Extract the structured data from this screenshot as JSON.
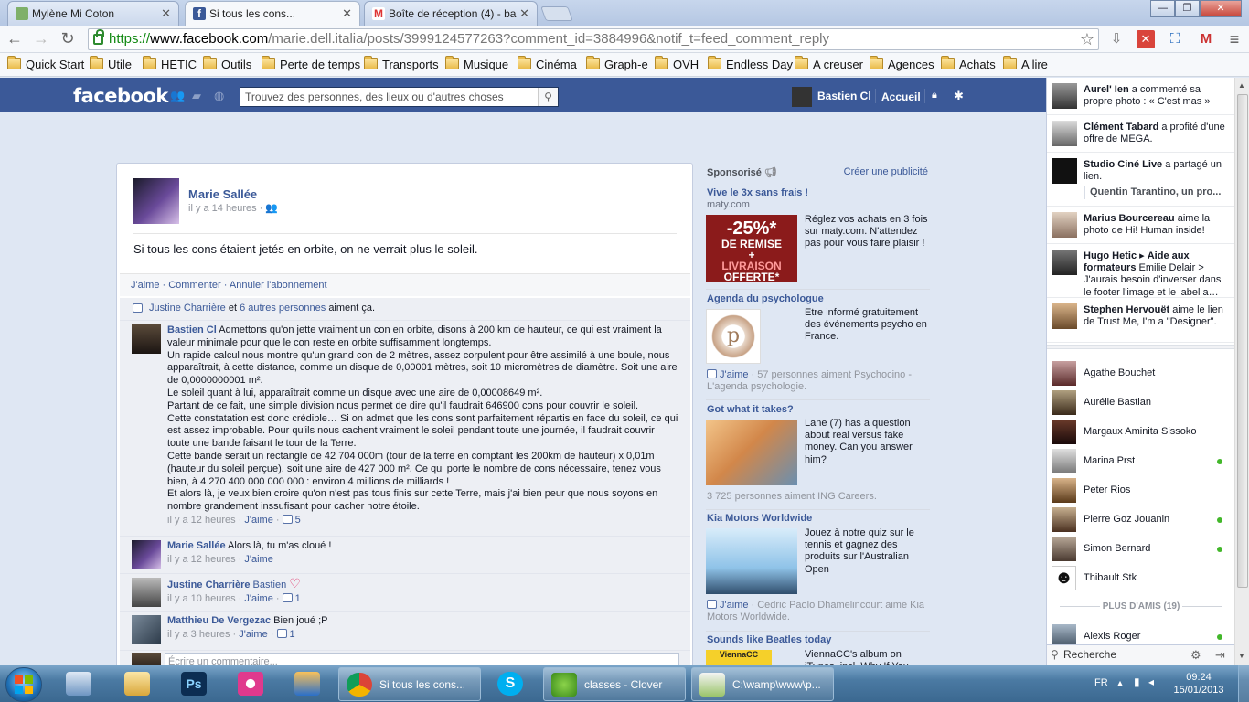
{
  "browser": {
    "tabs": [
      {
        "title": "Mylène Mi Coton",
        "active": false
      },
      {
        "title": "Si tous les cons...",
        "active": true
      },
      {
        "title": "Boîte de réception (4) - ba",
        "active": false
      }
    ],
    "url": {
      "scheme": "https://",
      "host": "www.facebook.com",
      "path": "/marie.dell.italia/posts/3999124577263?comment_id=3884996&notif_t=feed_comment_reply"
    },
    "bookmarks": [
      "Quick Start",
      "Utile",
      "HETIC",
      "Outils",
      "Perte de temps",
      "Transports",
      "Musique",
      "Cinéma",
      "Graph-e",
      "OVH",
      "Endless Day",
      "A creuser",
      "Agences",
      "Achats",
      "A lire"
    ]
  },
  "fb_header": {
    "logo": "facebook",
    "search_placeholder": "Trouvez des personnes, des lieux ou d'autres choses",
    "user_name": "Bastien Cl",
    "home_label": "Accueil"
  },
  "post": {
    "author": "Marie Sallée",
    "time": "il y a 14 heures",
    "text": "Si tous les cons étaient jetés en orbite, on ne verrait plus le soleil.",
    "actions": {
      "like": "J'aime",
      "comment": "Commenter",
      "unsubscribe": "Annuler l'abonnement"
    },
    "likes_summary": {
      "name": "Justine Charrière",
      "connector": "et",
      "others": "6 autres personnes",
      "suffix": "aiment ça."
    },
    "comments": [
      {
        "author": "Bastien Cl",
        "paragraphs": [
          "Admettons qu'on jette vraiment un con en orbite, disons à 200 km de hauteur, ce qui est vraiment la valeur minimale pour que le con reste en orbite suffisamment longtemps.",
          "Un rapide calcul nous montre qu'un grand con de 2 mètres, assez corpulent pour être assimilé à une boule, nous apparaîtrait, à cette distance, comme un disque de 0,00001 mètres, soit 10 micromètres de diamètre. Soit une aire de 0,0000000001 m².",
          "Le soleil quant à lui, apparaîtrait comme un disque avec une aire de 0,00008649 m².",
          "Partant de ce fait, une simple division nous permet de dire qu'il faudrait 646900 cons pour couvrir le soleil.",
          "Cette constatation est donc crédible… Si on admet que les cons sont parfaitement répartis en face du soleil, ce qui est assez improbable. Pour qu'ils nous cachent vraiment le soleil pendant toute une journée, il faudrait couvrir toute une bande faisant le tour de la Terre.",
          "Cette bande serait un rectangle de 42 704 000m (tour de la terre en comptant les 200km de hauteur) x 0,01m (hauteur du soleil perçue), soit une aire de 427 000 m². Ce qui porte le nombre de cons nécessaire, tenez vous bien, à 4 270 400 000 000 000 : environ 4 millions de milliards !",
          "Et alors là, je veux bien croire qu'on n'est pas tous finis sur cette Terre, mais j'ai bien peur que nous soyons en nombre grandement inssufisant pour cacher notre étoile."
        ],
        "time": "il y a 12 heures",
        "like": "J'aime",
        "like_count": "5"
      },
      {
        "author": "Marie Sallée",
        "text": "Alors là, tu m'as cloué !",
        "time": "il y a 12 heures",
        "like": "J'aime",
        "like_count": ""
      },
      {
        "author": "Justine Charrière",
        "text": "Bastien",
        "time": "il y a 10 heures",
        "like": "J'aime",
        "like_count": "1",
        "heart": "♡"
      },
      {
        "author": "Matthieu De Vergezac",
        "text": "Bien joué ;P",
        "time": "il y a 3 heures",
        "like": "J'aime",
        "like_count": "1"
      }
    ],
    "write_placeholder": "Écrire un commentaire..."
  },
  "ads": {
    "header": "Sponsorisé",
    "create": "Créer une publicité",
    "items": [
      {
        "title": "Vive le 3x sans frais !",
        "domain": "maty.com",
        "text": "Réglez vos achats en 3 fois sur maty.com. N'attendez pas pour vous faire plaisir !",
        "banner": [
          "-25%*",
          "DE REMISE",
          "+",
          "LIVRAISON",
          "OFFERTE*"
        ]
      },
      {
        "title": "Agenda du psychologue",
        "text": "Etre informé gratuitement des événements psycho en France.",
        "like": "J'aime",
        "social": "57 personnes aiment Psychocino - L'agenda psychologie."
      },
      {
        "title": "Got what it takes?",
        "text": "Lane (7) has a question about real versus fake money. Can you answer him?",
        "social": "3 725 personnes aiment ING Careers."
      },
      {
        "title": "Kia Motors Worldwide",
        "text": "Jouez à notre quiz sur le tennis et gagnez des produits sur l'Australian Open",
        "like": "J'aime",
        "social": "Cedric Paolo Dhamelincourt aime Kia Motors Worldwide."
      },
      {
        "title": "Sounds like Beatles today",
        "text": "ViennaCC's album on iTunes, incl. Why If You",
        "img_label": "ViennaCC"
      }
    ]
  },
  "ticker": [
    {
      "name": "Aurel' Ien",
      "text": "a commenté sa propre photo : « C'est mas »"
    },
    {
      "name": "Clément Tabard",
      "text": "a profité d'une offre de MEGA."
    },
    {
      "name": "Studio Ciné Live",
      "text": "a partagé un lien.",
      "sub": "Quentin Tarantino, un pro..."
    },
    {
      "name": "Marius Bourcereau",
      "text": "aime la photo de Hi! Human inside!"
    },
    {
      "name": "Hugo Hetic",
      "arrow": "▸",
      "target": "Aide aux formateurs",
      "text": "Emilie Delair > J'aurais besoin d'inverser dans le footer l'image et le label a…"
    },
    {
      "name": "Stephen Hervouët",
      "text": "aime le lien de Trust Me, I'm a \"Designer\"."
    }
  ],
  "chat": {
    "friends": [
      {
        "name": "Agathe Bouchet",
        "online": false
      },
      {
        "name": "Aurélie Bastian",
        "online": false
      },
      {
        "name": "Margaux Aminita Sissoko",
        "online": false
      },
      {
        "name": "Marina Prst",
        "online": true
      },
      {
        "name": "Peter Rios",
        "online": false
      },
      {
        "name": "Pierre Goz Jouanin",
        "online": true
      },
      {
        "name": "Simon Bernard",
        "online": true
      },
      {
        "name": "Thibault Stk",
        "online": false
      }
    ],
    "more_label": "PLUS D'AMIS (19)",
    "extra_friend": {
      "name": "Alexis Roger",
      "online": true
    },
    "search_label": "Recherche"
  },
  "taskbar": {
    "windows": [
      {
        "label": "Si tous les cons..."
      },
      {
        "label": "classes - Clover"
      },
      {
        "label": "C:\\wamp\\www\\p..."
      }
    ],
    "lang": "FR",
    "time": "09:24",
    "date": "15/01/2013"
  }
}
